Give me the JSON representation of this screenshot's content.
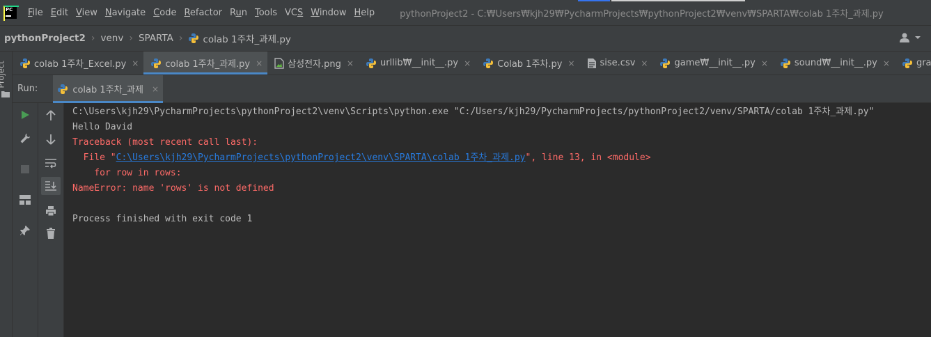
{
  "app": {
    "logo_icon": "pycharm-logo-icon",
    "menu": [
      "File",
      "Edit",
      "View",
      "Navigate",
      "Code",
      "Refactor",
      "Run",
      "Tools",
      "VCS",
      "Window",
      "Help"
    ],
    "menu_mnemonics": [
      "F",
      "E",
      "V",
      "N",
      "C",
      "R",
      "u",
      "T",
      "S",
      "W",
      "H"
    ],
    "window_title": "pythonProject2 - C:₩Users₩kjh29₩PycharmProjects₩pythonProject2₩venv₩SPARTA₩colab 1주차_과제.py"
  },
  "breadcrumb": {
    "items": [
      "pythonProject2",
      "venv",
      "SPARTA",
      "colab 1주차_과제.py"
    ],
    "user_icon": "user-account-icon"
  },
  "sidebar": {
    "project_label": "Project"
  },
  "editor_tabs": [
    {
      "label": "colab 1주차_Excel.py",
      "icon": "python-file-icon",
      "active": false
    },
    {
      "label": "colab 1주차_과제.py",
      "icon": "python-file-icon",
      "active": true
    },
    {
      "label": "삼성전자.png",
      "icon": "image-file-icon",
      "active": false
    },
    {
      "label": "urllib₩__init__.py",
      "icon": "python-file-icon",
      "active": false
    },
    {
      "label": "Colab 1주차.py",
      "icon": "python-file-icon",
      "active": false
    },
    {
      "label": "sise.csv",
      "icon": "text-file-icon",
      "active": false
    },
    {
      "label": "game₩__init__.py",
      "icon": "python-file-icon",
      "active": false
    },
    {
      "label": "sound₩__init__.py",
      "icon": "python-file-icon",
      "active": false
    },
    {
      "label": "graph",
      "icon": "python-file-icon",
      "active": false
    }
  ],
  "run_panel": {
    "label": "Run:",
    "tab_label": "colab 1주차_과제",
    "close_glyph": "×"
  },
  "console": {
    "cmd_line": "C:\\Users\\kjh29\\PycharmProjects\\pythonProject2\\venv\\Scripts\\python.exe \"C:/Users/kjh29/PycharmProjects/pythonProject2/venv/SPARTA/colab 1주차_과제.py\"",
    "output_line": "Hello David",
    "traceback_header": "Traceback (most recent call last):",
    "file_prefix": "  File \"",
    "file_link": "C:\\Users\\kjh29\\PycharmProjects\\pythonProject2\\venv\\SPARTA\\colab 1주차_과제.py",
    "file_suffix": "\", line 13, in <module>",
    "code_line": "    for row in rows:",
    "error_line": "NameError: name 'rows' is not defined",
    "exit_line": "Process finished with exit code 1"
  },
  "colors": {
    "error": "#ff6b68",
    "link": "#287bde",
    "run_green": "#499c54",
    "accent": "#4a88c7"
  }
}
